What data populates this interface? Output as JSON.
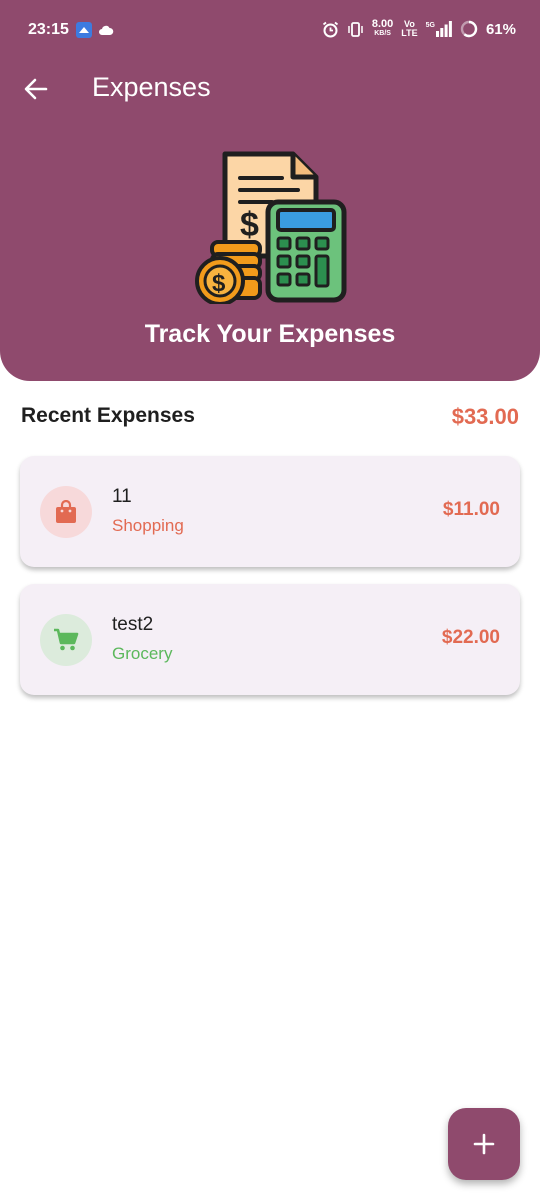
{
  "status_bar": {
    "time": "23:15",
    "speed_value": "8.00",
    "speed_unit": "KB/S",
    "volte_top": "Vo",
    "volte_bottom": "LTE",
    "network": "5G",
    "battery": "61%"
  },
  "header": {
    "title": "Expenses",
    "hero_text": "Track Your Expenses"
  },
  "recent": {
    "title": "Recent Expenses",
    "total": "$33.00"
  },
  "expenses": [
    {
      "name": "11",
      "category": "Shopping",
      "amount": "$11.00",
      "icon": "shopping-bag-icon",
      "category_color": "#e26a52",
      "icon_bg": "#f7d9da"
    },
    {
      "name": "test2",
      "category": "Grocery",
      "amount": "$22.00",
      "icon": "cart-icon",
      "category_color": "#5cb85c",
      "icon_bg": "#dcebdc"
    }
  ],
  "colors": {
    "primary": "#8f4a6d",
    "amount": "#e26a52"
  },
  "fab": {
    "icon": "plus-icon"
  }
}
